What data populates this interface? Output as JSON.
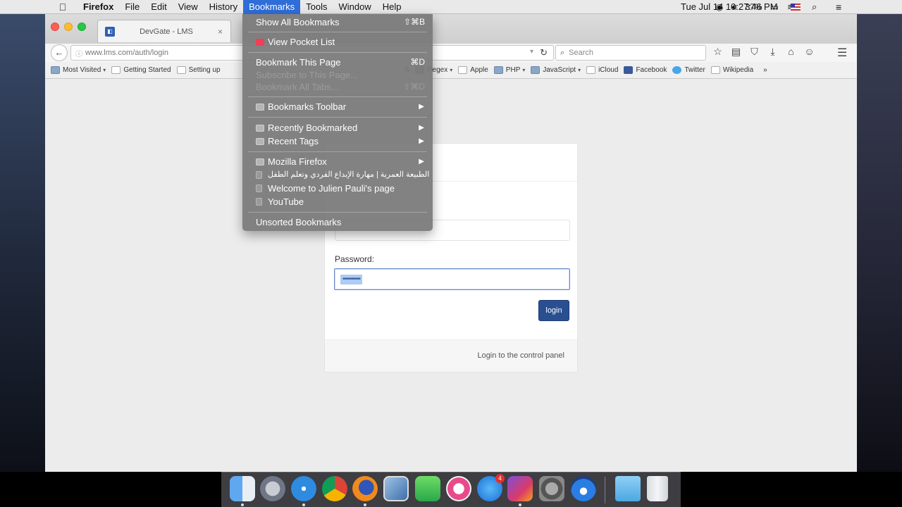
{
  "menubar": {
    "app_name": "Firefox",
    "items": [
      "File",
      "Edit",
      "View",
      "History",
      "Bookmarks",
      "Tools",
      "Window",
      "Help"
    ],
    "battery": "37%",
    "clock": "Tue Jul 14  10:27:46 PM"
  },
  "tab": {
    "title": "DevGate - LMS",
    "close": "×"
  },
  "navbar": {
    "url": "www.lms.com/auth/login",
    "search_placeholder": "Search"
  },
  "bookmarks_bar": {
    "items": [
      {
        "label": "Most Visited",
        "icon": "folder",
        "dropdown": true
      },
      {
        "label": "Getting Started",
        "icon": "page",
        "dropdown": false
      },
      {
        "label": "Setting up",
        "icon": "page",
        "dropdown": false
      },
      {
        "label": "S",
        "icon": "page",
        "dropdown": false
      },
      {
        "label": "Regex",
        "icon": "folder",
        "dropdown": true
      },
      {
        "label": "Apple",
        "icon": "page",
        "dropdown": false
      },
      {
        "label": "PHP",
        "icon": "folder",
        "dropdown": true
      },
      {
        "label": "JavaScript",
        "icon": "folder",
        "dropdown": true
      },
      {
        "label": "iCloud",
        "icon": "page",
        "dropdown": false
      },
      {
        "label": "Facebook",
        "icon": "fb",
        "dropdown": false
      },
      {
        "label": "Twitter",
        "icon": "tw",
        "dropdown": false
      },
      {
        "label": "Wikipedia",
        "icon": "page",
        "dropdown": false
      }
    ],
    "overflow": "»"
  },
  "bookmarks_menu": {
    "show_all": "Show All Bookmarks",
    "show_all_shortcut": "⇧⌘B",
    "view_pocket": "View Pocket List",
    "bookmark_page": "Bookmark This Page",
    "bookmark_page_shortcut": "⌘D",
    "subscribe": "Subscribe to This Page...",
    "bookmark_all_tabs": "Bookmark All Tabs...",
    "bookmark_all_tabs_shortcut": "⇧⌘D",
    "toolbar": "Bookmarks Toolbar",
    "recently_bookmarked": "Recently Bookmarked",
    "recent_tags": "Recent Tags",
    "mozilla_firefox": "Mozilla Firefox",
    "arabic_item": "الطبيعة العمرية | مهارة الإبداع الفردي وتعلم الطفل",
    "julien": "Welcome to Julien Pauli's page",
    "youtube": "YouTube",
    "unsorted": "Unsorted Bookmarks"
  },
  "login": {
    "password_label": "Password:",
    "password_value": "••••••••••",
    "login_button": "login",
    "footer_text": "Login to the control panel"
  },
  "colors": {
    "menu_highlight": "#2f6ed8",
    "login_button": "#2a4f91",
    "pocket": "#ef4056"
  },
  "dock": {
    "apps": [
      "Finder",
      "Launchpad",
      "Safari",
      "Chrome",
      "Firefox",
      "Preview",
      "Messages",
      "iTunes",
      "App Store",
      "PhpStorm",
      "System Preferences",
      "Migration",
      "Downloads",
      "Trash"
    ],
    "app_store_badge": "4"
  }
}
